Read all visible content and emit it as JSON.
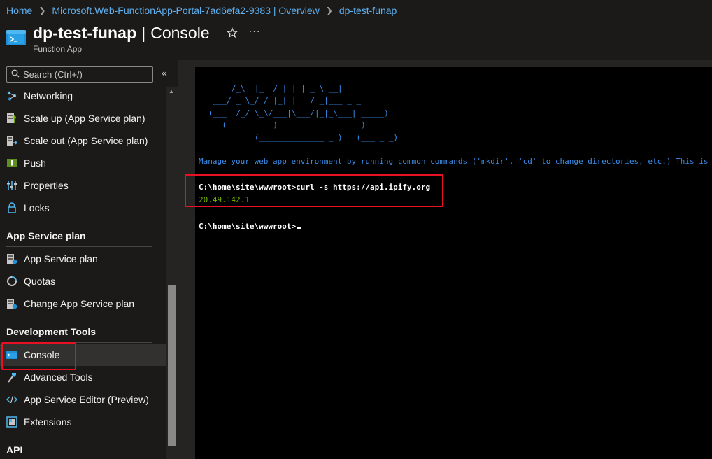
{
  "breadcrumb": {
    "items": [
      "Home",
      "Microsoft.Web-FunctionApp-Portal-7ad6efa2-9383 | Overview",
      "dp-test-funap"
    ]
  },
  "header": {
    "resource_name": "dp-test-funap",
    "separator": "|",
    "view_name": "Console",
    "resource_type": "Function App",
    "icons": {
      "app": "console-app-icon",
      "favorite": "star-icon",
      "more": "more-icon"
    },
    "more_glyph": "···"
  },
  "sidebar": {
    "search_placeholder": "Search (Ctrl+/)",
    "collapse_glyph": "«",
    "items": [
      {
        "label": "Networking",
        "icon": "networking-icon"
      },
      {
        "label": "Scale up (App Service plan)",
        "icon": "scale-up-icon"
      },
      {
        "label": "Scale out (App Service plan)",
        "icon": "scale-out-icon"
      },
      {
        "label": "Push",
        "icon": "push-icon"
      },
      {
        "label": "Properties",
        "icon": "properties-icon"
      },
      {
        "label": "Locks",
        "icon": "lock-icon"
      }
    ],
    "sections": [
      {
        "title": "App Service plan",
        "items": [
          {
            "label": "App Service plan",
            "icon": "app-service-plan-icon"
          },
          {
            "label": "Quotas",
            "icon": "quotas-icon"
          },
          {
            "label": "Change App Service plan",
            "icon": "change-plan-icon"
          }
        ]
      },
      {
        "title": "Development Tools",
        "items": [
          {
            "label": "Console",
            "icon": "console-icon",
            "selected": true
          },
          {
            "label": "Advanced Tools",
            "icon": "advanced-tools-icon"
          },
          {
            "label": "App Service Editor (Preview)",
            "icon": "code-editor-icon"
          },
          {
            "label": "Extensions",
            "icon": "extensions-icon"
          }
        ]
      },
      {
        "title": "API",
        "items": []
      }
    ]
  },
  "console": {
    "ascii_art": [
      "       _    ____   _ ___ ___",
      "      /_\\  |_  / | | | _ \\ __|",
      "  ___/ _ \\_/ / |_| |   / _|___ _ _",
      " (___  /_/ \\_\\/___|\\___/|_|_\\___| _____)",
      "    (______ _ _)        _ ______ _)_ _",
      "           (______________ _ )   (___ _ _)"
    ],
    "welcome": "Manage your web app environment by running common commands ('mkdir', 'cd' to change directories, etc.) This is a",
    "command": "C:\\home\\site\\wwwroot>curl -s https://api.ipify.org",
    "output": "20.49.142.1",
    "prompt": "C:\\home\\site\\wwwroot>"
  },
  "colors": {
    "accent_link": "#5eb0ef",
    "console_text": "#3b8eea",
    "output": "#76b900",
    "highlight": "#e81123"
  }
}
